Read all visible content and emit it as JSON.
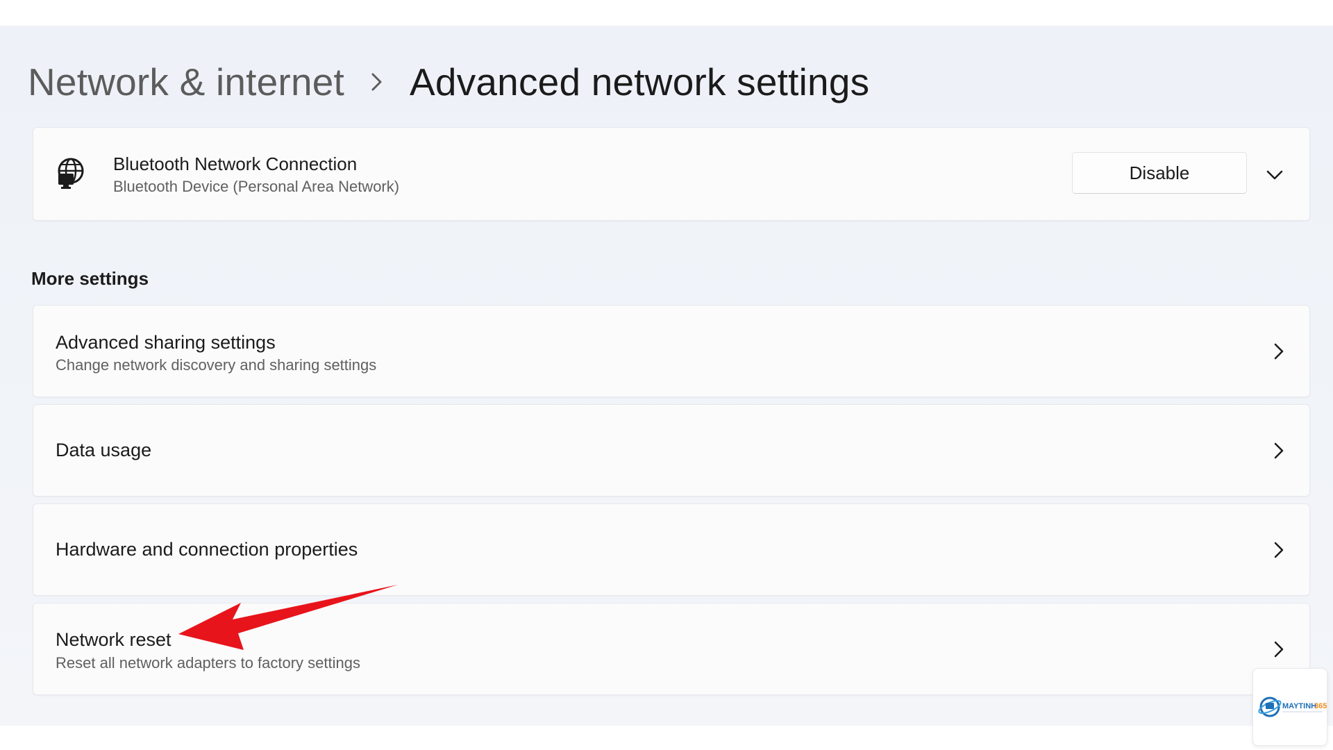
{
  "breadcrumb": {
    "parent": "Network & internet",
    "separator_icon": "chevron-right-icon",
    "current": "Advanced network settings"
  },
  "adapter": {
    "icon": "globe-monitor-icon",
    "title": "Bluetooth Network Connection",
    "subtitle": "Bluetooth Device (Personal Area Network)",
    "disable_label": "Disable",
    "expand_icon": "chevron-down-icon"
  },
  "more_settings": {
    "heading": "More settings",
    "items": [
      {
        "title": "Advanced sharing settings",
        "subtitle": "Change network discovery and sharing settings",
        "icon": "chevron-right-icon"
      },
      {
        "title": "Data usage",
        "subtitle": "",
        "icon": "chevron-right-icon"
      },
      {
        "title": "Hardware and connection properties",
        "subtitle": "",
        "icon": "chevron-right-icon"
      },
      {
        "title": "Network reset",
        "subtitle": "Reset all network adapters to factory settings",
        "icon": "chevron-right-icon"
      }
    ]
  },
  "annotation": {
    "icon": "red-arrow-icon",
    "color": "#e8141b"
  },
  "watermark": {
    "logo_text": "MAYTINH365"
  },
  "colors": {
    "background": "#eef2f8",
    "card": "#fbfbfc",
    "text_primary": "#1b1b1b",
    "text_secondary": "#606060"
  }
}
